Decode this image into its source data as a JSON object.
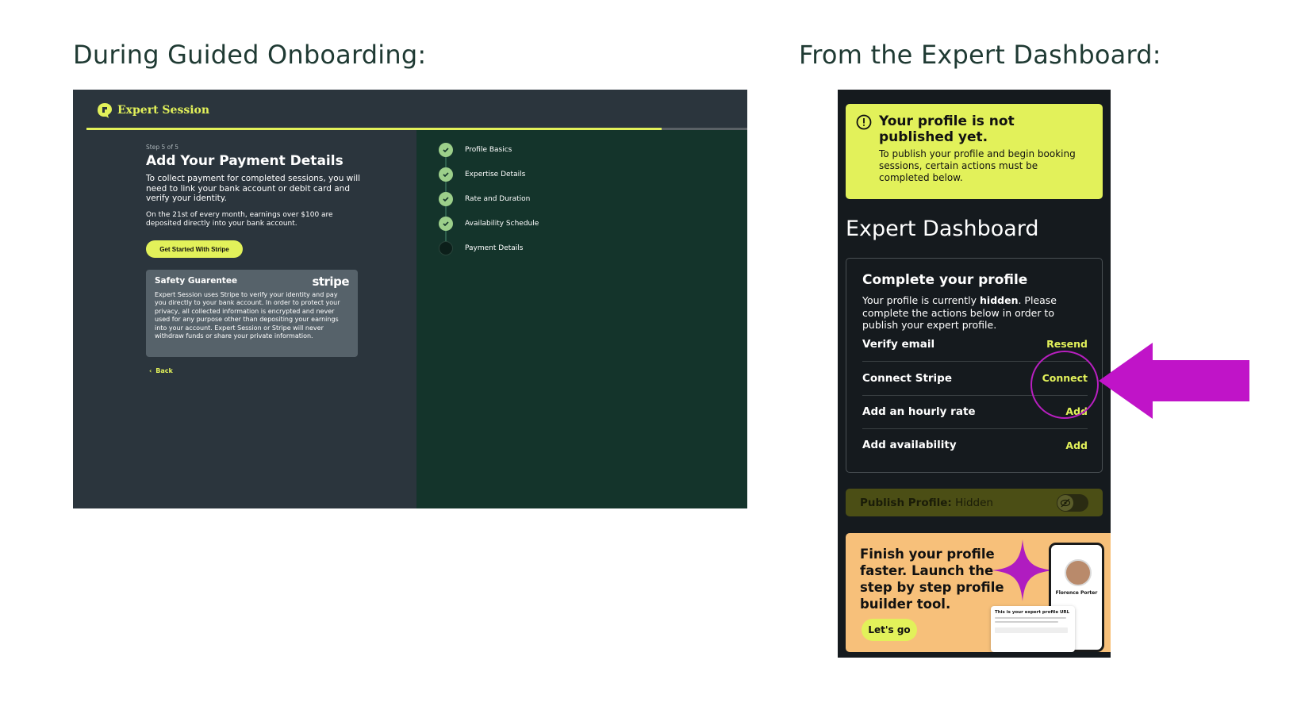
{
  "headings": {
    "left": "During Guided Onboarding:",
    "right": "From the Expert Dashboard:"
  },
  "onboarding": {
    "logo_text": "Expert Session",
    "progress": 0.87,
    "step_label": "Step 5 of 5",
    "title": "Add Your Payment Details",
    "description": "To collect payment for completed sessions, you will need to link your bank account or debit card and verify your identity.",
    "payout_note": "On the 21st of every month, earnings over $100 are deposited directly into your bank account.",
    "stripe_button": "Get Started With Stripe",
    "safety_title": "Safety Guarentee",
    "safety_logo": "stripe",
    "safety_text": "Expert Session uses Stripe to verify your identity and pay you directly to your bank account. In order to protect your privacy, all collected information is encrypted and never used for any purpose other than depositing your earnings into your account. Expert Session or Stripe will never withdraw funds or share your private information.",
    "back_label": "Back",
    "steps": [
      {
        "label": "Profile Basics",
        "done": true
      },
      {
        "label": "Expertise Details",
        "done": true
      },
      {
        "label": "Rate and Duration",
        "done": true
      },
      {
        "label": "Availability Schedule",
        "done": true
      },
      {
        "label": "Payment Details",
        "done": false
      }
    ]
  },
  "dashboard": {
    "alert_title": "Your profile is not published yet.",
    "alert_text": "To publish your profile and begin booking sessions, certain actions must be completed below.",
    "title": "Expert Dashboard",
    "card_title": "Complete your profile",
    "card_desc_prefix": "Your profile is currently ",
    "card_desc_bold": "hidden",
    "card_desc_suffix": ". Please complete the actions below in order to publish your expert profile.",
    "rows": [
      {
        "label": "Verify email",
        "action": "Resend"
      },
      {
        "label": "Connect Stripe",
        "action": "Connect"
      },
      {
        "label": "Add an hourly rate",
        "action": "Add"
      },
      {
        "label": "Add availability",
        "action": "Add"
      }
    ],
    "publish_label": "Publish Profile:",
    "publish_value": " Hidden",
    "promo_text": "Finish your profile faster. Launch the step by step profile builder tool.",
    "promo_button": "Let's go",
    "promo_profile_name": "Florence Porter",
    "promo_card_title": "This is your expert profile URL"
  },
  "colors": {
    "accent": "#e2f15a",
    "annotation": "#c014c8"
  }
}
